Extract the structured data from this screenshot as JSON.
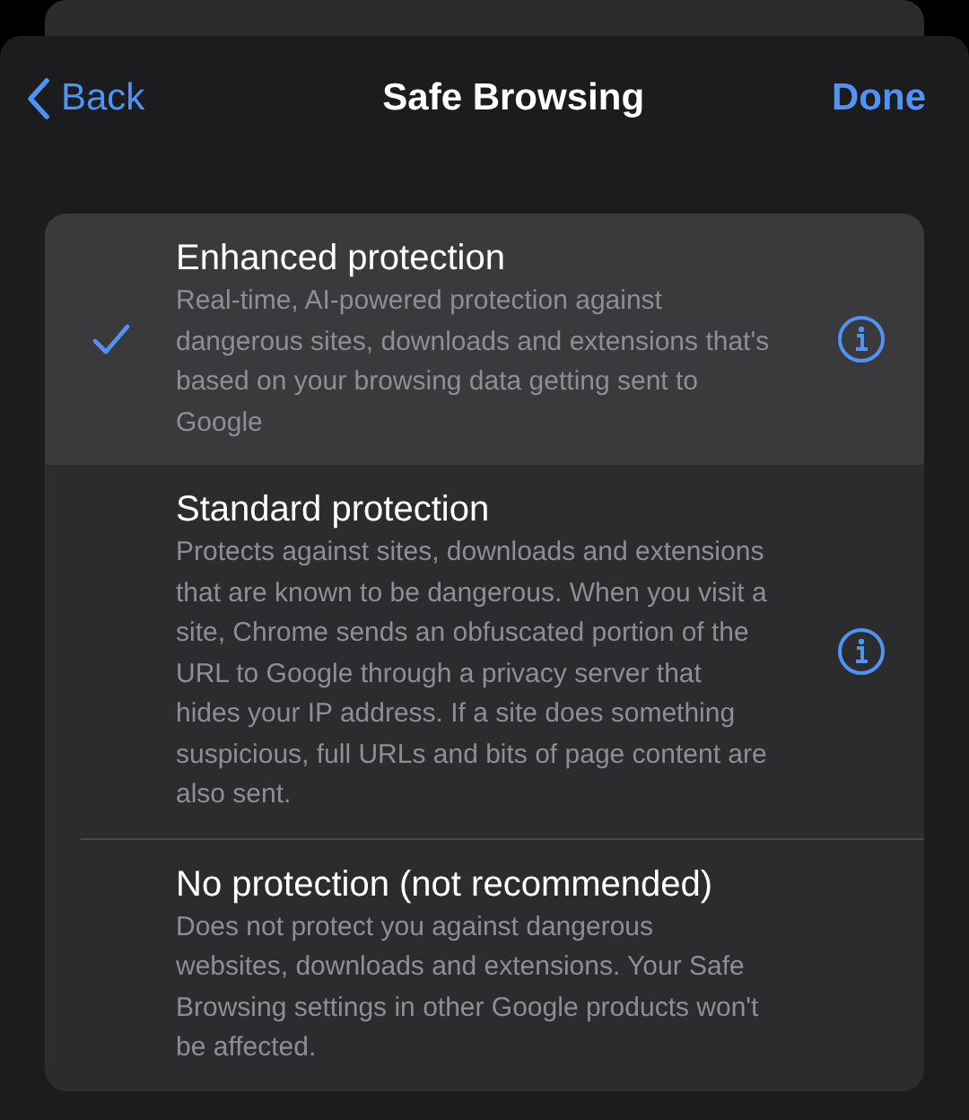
{
  "nav": {
    "back": "Back",
    "title": "Safe Browsing",
    "done": "Done"
  },
  "options": [
    {
      "title": "Enhanced protection",
      "description": "Real-time, AI-powered protection against dangerous sites, downloads and extensions that's based on your browsing data getting sent to Google",
      "selected": true,
      "info_button": true
    },
    {
      "title": "Standard protection",
      "description": "Protects against sites, downloads and extensions that are known to be dangerous. When you visit a site, Chrome sends an obfuscated portion of the URL to Google through a privacy server that hides your IP address. If a site does something suspicious, full URLs and bits of page content are also sent.",
      "selected": false,
      "info_button": true
    },
    {
      "title": "No protection (not recommended)",
      "description": "Does not protect you against dangerous websites, downloads and extensions. Your Safe Browsing settings in other Google products won't be affected.",
      "selected": false,
      "info_button": false
    }
  ]
}
